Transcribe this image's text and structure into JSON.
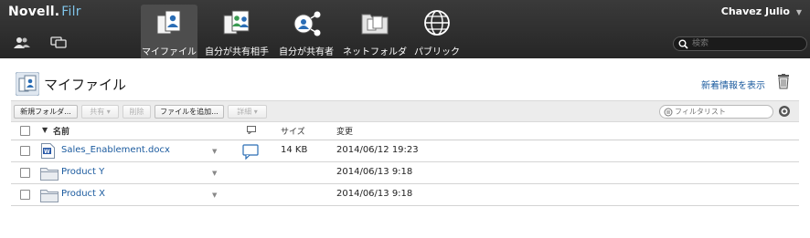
{
  "header": {
    "brand_main": "Novell.",
    "brand_sub": "Filr",
    "user_name": "Chavez Julio",
    "search_placeholder": "検索",
    "nav": [
      {
        "label": "マイファイル",
        "icon": "my-files-icon",
        "active": true
      },
      {
        "label": "自分が共有相手",
        "icon": "shared-with-me-icon",
        "active": false
      },
      {
        "label": "自分が共有者",
        "icon": "shared-by-me-icon",
        "active": false
      },
      {
        "label": "ネットフォルダ",
        "icon": "net-folders-icon",
        "active": false
      },
      {
        "label": "パブリック",
        "icon": "public-globe-icon",
        "active": false
      }
    ]
  },
  "page": {
    "title": "マイファイル",
    "whats_new_link": "新着情報を表示"
  },
  "toolbar": {
    "new_folder": "新規フォルダ...",
    "share": "共有",
    "delete": "削除",
    "add_files": "ファイルを追加...",
    "more": "詳細",
    "filter_placeholder": "フィルタリスト"
  },
  "table": {
    "columns": {
      "name": "名前",
      "size": "サイズ",
      "modified": "変更"
    },
    "rows": [
      {
        "name": "Sales_Enablement.docx",
        "type": "docx",
        "has_comment": true,
        "size": "14 KB",
        "modified": "2014/06/12 19:23"
      },
      {
        "name": "Product Y",
        "type": "folder",
        "has_comment": false,
        "size": "",
        "modified": "2014/06/13 9:18"
      },
      {
        "name": "Product X",
        "type": "folder",
        "has_comment": false,
        "size": "",
        "modified": "2014/06/13 9:18"
      }
    ]
  },
  "colors": {
    "topbar": "#2e2e2e",
    "link": "#1a5a9e",
    "accent": "#7fc3e8"
  }
}
